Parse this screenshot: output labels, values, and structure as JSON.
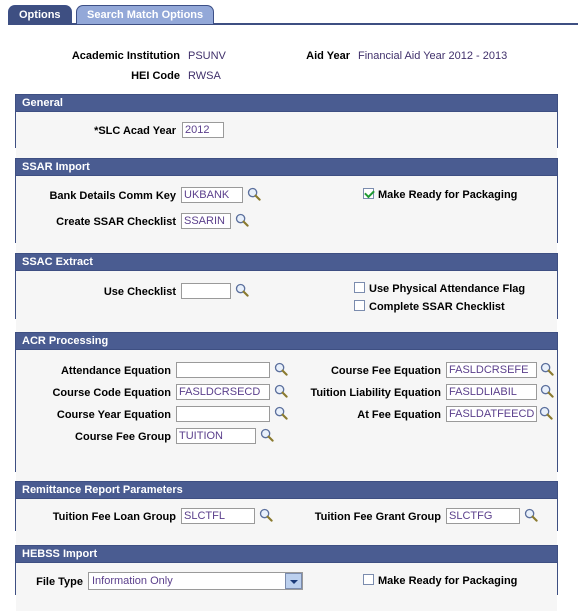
{
  "tabs": [
    {
      "label": "Options",
      "active": true
    },
    {
      "label": "Search Match Options",
      "active": false
    }
  ],
  "header": {
    "academic_institution_label": "Academic Institution",
    "academic_institution_value": "PSUNV",
    "aid_year_label": "Aid Year",
    "aid_year_value": "Financial Aid Year 2012 - 2013",
    "hei_code_label": "HEI Code",
    "hei_code_value": "RWSA"
  },
  "general": {
    "title": "General",
    "slc_acad_year_label": "*SLC Acad Year",
    "slc_acad_year_value": "2012"
  },
  "ssar_import": {
    "title": "SSAR Import",
    "bank_details_label": "Bank Details Comm Key",
    "bank_details_value": "UKBANK",
    "create_checklist_label": "Create SSAR Checklist",
    "create_checklist_value": "SSARIN",
    "make_ready_label": "Make Ready for Packaging",
    "make_ready_checked": true,
    "lookup_icon": "search-lookup-icon"
  },
  "ssac_extract": {
    "title": "SSAC Extract",
    "use_checklist_label": "Use Checklist",
    "use_checklist_value": "",
    "use_physical_label": "Use Physical Attendance Flag",
    "use_physical_checked": false,
    "complete_ssar_label": "Complete SSAR Checklist",
    "complete_ssar_checked": false
  },
  "acr_processing": {
    "title": "ACR Processing",
    "attendance_equation_label": "Attendance Equation",
    "attendance_equation_value": "",
    "course_code_equation_label": "Course Code Equation",
    "course_code_equation_value": "FASLDCRSECD",
    "course_year_equation_label": "Course Year Equation",
    "course_year_equation_value": "",
    "course_fee_group_label": "Course Fee Group",
    "course_fee_group_value": "TUITION",
    "course_fee_equation_label": "Course Fee Equation",
    "course_fee_equation_value": "FASLDCRSEFE",
    "tuition_liability_equation_label": "Tuition Liability Equation",
    "tuition_liability_equation_value": "FASLDLIABIL",
    "at_fee_equation_label": "At Fee Equation",
    "at_fee_equation_value": "FASLDATFEECD"
  },
  "remittance": {
    "title": "Remittance Report Parameters",
    "loan_group_label": "Tuition Fee Loan Group",
    "loan_group_value": "SLCTFL",
    "grant_group_label": "Tuition Fee Grant Group",
    "grant_group_value": "SLCTFG"
  },
  "hebss_import": {
    "title": "HEBSS Import",
    "file_type_label": "File Type",
    "file_type_value": "Information Only",
    "file_type_options": [
      "Information Only"
    ],
    "make_ready_label": "Make Ready for Packaging",
    "make_ready_checked": false
  },
  "colors": {
    "header_blue": "#4a5c91",
    "border_blue": "#3e4f82",
    "tab_inactive": "#93a8d8",
    "value_purple": "#40306b",
    "field_text": "#5b3f8c",
    "check_green": "#1f9a33"
  }
}
